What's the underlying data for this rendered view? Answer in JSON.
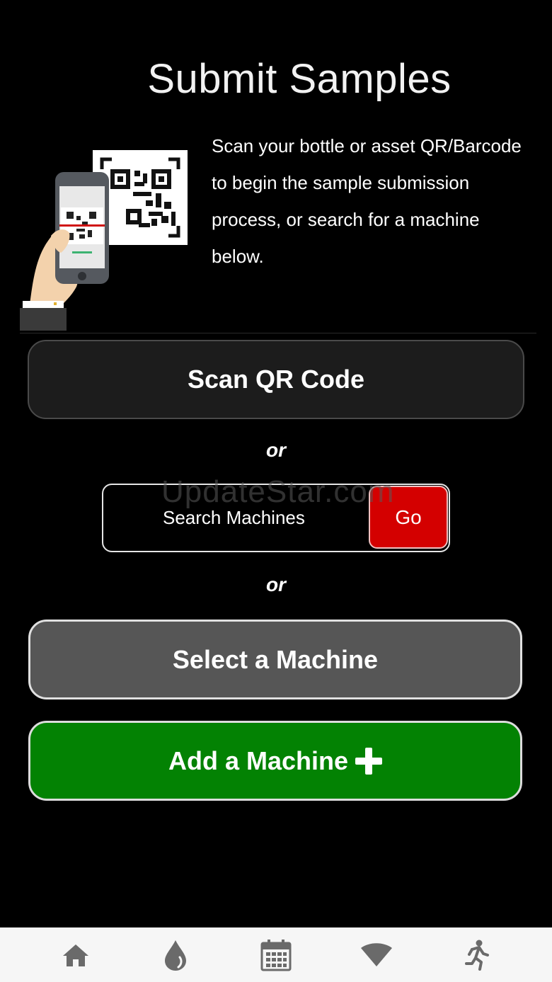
{
  "header": {
    "title": "Submit Samples"
  },
  "intro": {
    "text": "Scan your bottle or asset QR/Barcode to begin the sample submission process, or search for a machine below."
  },
  "actions": {
    "scan_label": "Scan QR Code",
    "or_label": "or",
    "search_placeholder": "Search Machines",
    "search_value": "",
    "go_label": "Go",
    "select_label": "Select a Machine",
    "add_label": "Add a Machine"
  },
  "watermark": "UpdateStar.com",
  "colors": {
    "background": "#000000",
    "go_button": "#d40000",
    "select_button": "#565656",
    "add_button": "#038203",
    "tab_bar": "#f6f6f6",
    "tab_icon": "#6a6a6a"
  },
  "tab_bar": {
    "items": [
      {
        "icon": "home-icon"
      },
      {
        "icon": "drop-icon"
      },
      {
        "icon": "calendar-icon"
      },
      {
        "icon": "wifi-icon"
      },
      {
        "icon": "running-person-icon"
      }
    ]
  }
}
